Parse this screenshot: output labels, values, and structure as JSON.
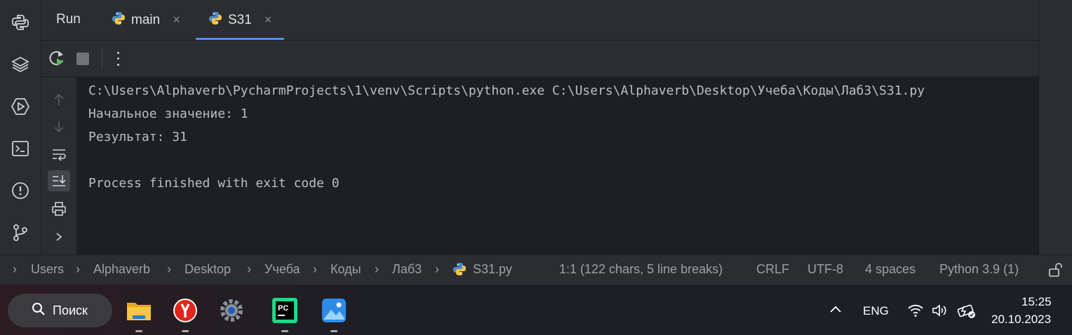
{
  "run_panel": {
    "title": "Run",
    "tabs": [
      {
        "label": "main",
        "close": "×"
      },
      {
        "label": "S31",
        "close": "×"
      }
    ]
  },
  "console": {
    "lines": [
      "C:\\Users\\Alphaverb\\PycharmProjects\\1\\venv\\Scripts\\python.exe C:\\Users\\Alphaverb\\Desktop\\Учеба\\Коды\\Лаб3\\S31.py",
      "Начальное значение: 1",
      "Результат: 31",
      "",
      "Process finished with exit code 0"
    ]
  },
  "breadcrumbs": [
    "Users",
    "Alphaverb",
    "Desktop",
    "Учеба",
    "Коды",
    "Лаб3",
    "S31.py"
  ],
  "statusbar": {
    "position": "1:1 (122 chars, 5 line breaks)",
    "line_separator": "CRLF",
    "encoding": "UTF-8",
    "indent": "4 spaces",
    "interpreter": "Python 3.9 (1)"
  },
  "taskbar": {
    "search_label": "Поиск",
    "language": "ENG",
    "time": "15:25",
    "date": "20.10.2023",
    "apps": [
      "file-explorer",
      "yandex-browser",
      "settings",
      "pycharm",
      "photos"
    ]
  },
  "colors": {
    "accent": "#548af7",
    "console_bg": "#1e1f22",
    "panel_bg": "#2b2d30"
  }
}
